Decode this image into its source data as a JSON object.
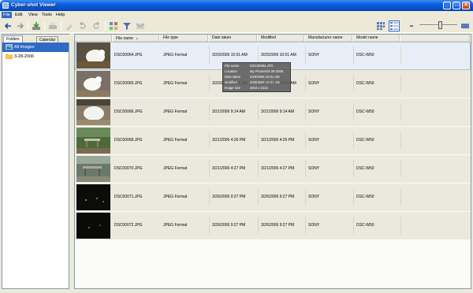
{
  "window": {
    "title": "Cyber-shot Viewer"
  },
  "menu": [
    {
      "label": "File",
      "active": true
    },
    {
      "label": "Edit"
    },
    {
      "label": "View"
    },
    {
      "label": "Tools"
    },
    {
      "label": "Help"
    }
  ],
  "sidebar": {
    "tabs": [
      "Folders",
      "Calendar"
    ],
    "tree": [
      {
        "label": "All Images",
        "selected": true,
        "icon": "all-images-icon"
      },
      {
        "label": "3-28-2006",
        "icon": "folder-icon"
      }
    ]
  },
  "columns": [
    "File name",
    "File type",
    "Date taken",
    "Modified",
    "Manufacturer name",
    "Model name"
  ],
  "rows": [
    {
      "file_name": "DSC00064.JPG",
      "file_type": "JPEG Format",
      "date_taken": "3/20/2006 10:01 AM",
      "modified": "3/20/2006 10:01 AM",
      "manufacturer": "SONY",
      "model": "DSC-W50",
      "selected": true
    },
    {
      "file_name": "DSC00065.JPG",
      "file_type": "JPEG Format",
      "date_taken": "3/20/2006 10:01 AM",
      "modified": "3/20/2006 10:01 AM",
      "manufacturer": "SONY",
      "model": "DSC-W50"
    },
    {
      "file_name": "DSC00066.JPG",
      "file_type": "JPEG Format",
      "date_taken": "3/21/2006 9:14 AM",
      "modified": "3/21/2006 9:14 AM",
      "manufacturer": "SONY",
      "model": "DSC-W50"
    },
    {
      "file_name": "DSC00068.JPG",
      "file_type": "JPEG Format",
      "date_taken": "3/21/2006 4:26 PM",
      "modified": "3/21/2006 4:26 PM",
      "manufacturer": "SONY",
      "model": "DSC-W50"
    },
    {
      "file_name": "DSC00070.JPG",
      "file_type": "JPEG Format",
      "date_taken": "3/21/2006 4:27 PM",
      "modified": "3/21/2006 4:27 PM",
      "manufacturer": "SONY",
      "model": "DSC-W50"
    },
    {
      "file_name": "DSC00071.JPG",
      "file_type": "JPEG Format",
      "date_taken": "3/26/2006 9:27 PM",
      "modified": "3/26/2006 9:27 PM",
      "manufacturer": "SONY",
      "model": "DSC-W50"
    },
    {
      "file_name": "DSC00072.JPG",
      "file_type": "JPEG Format",
      "date_taken": "3/26/2006 9:27 PM",
      "modified": "3/26/2006 9:27 PM",
      "manufacturer": "SONY",
      "model": "DSC-W50"
    }
  ],
  "tooltip": [
    {
      "label": "File name",
      "value": "DSC00064.JPG"
    },
    {
      "label": "Location",
      "value": "My Pictures\\3-28-2006"
    },
    {
      "label": "Date taken",
      "value": "3/20/2006 10:01 AM"
    },
    {
      "label": "Modified",
      "value": "3/20/2006 10:01 AM"
    },
    {
      "label": "Image size",
      "value": "2816 x 2112"
    }
  ],
  "colors": {
    "title_bar": "#0a5ee0",
    "selection": "#316ac5",
    "row_bg": "#ebe9dd"
  }
}
